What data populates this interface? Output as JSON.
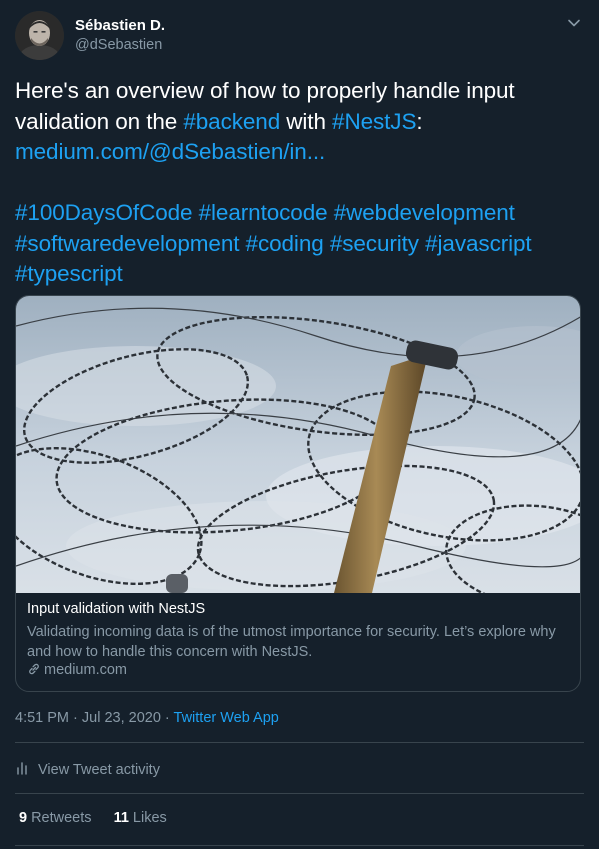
{
  "author": {
    "name": "Sébastien D.",
    "handle": "@dSebastien"
  },
  "tweet": {
    "line1": "Here's an overview of how to properly handle input",
    "line2_pre": "validation on the ",
    "hashtag_backend": "#backend",
    "line2_mid": " with ",
    "hashtag_nestjs": "#NestJS",
    "line2_post": ":",
    "url": "medium.com/@dSebastien/in...",
    "hashtags_line1": [
      "#100DaysOfCode",
      "#learntocode",
      "#webdevelopment"
    ],
    "hashtags_line2": [
      "#softwaredevelopment",
      "#coding",
      "#security",
      "#javascript"
    ],
    "hashtags_line3": [
      "#typescript"
    ]
  },
  "card": {
    "title": "Input validation with NestJS",
    "description": "Validating incoming data is of the utmost importance for security. Let’s explore why and how to handle this concern with NestJS.",
    "domain": "medium.com"
  },
  "meta": {
    "time": "4:51 PM",
    "separator1": " · ",
    "date": "Jul 23, 2020",
    "separator2": " · ",
    "source": "Twitter Web App"
  },
  "activity": {
    "label": "View Tweet activity"
  },
  "stats": {
    "retweets_count": "9",
    "retweets_label": "Retweets",
    "likes_count": "11",
    "likes_label": "Likes"
  },
  "colors": {
    "background": "#15202b",
    "accent": "#1da1f2",
    "secondary_text": "#8899a6",
    "border": "#38444d"
  },
  "icons": [
    "chevron-down-icon",
    "link-icon",
    "activity-bars-icon"
  ]
}
